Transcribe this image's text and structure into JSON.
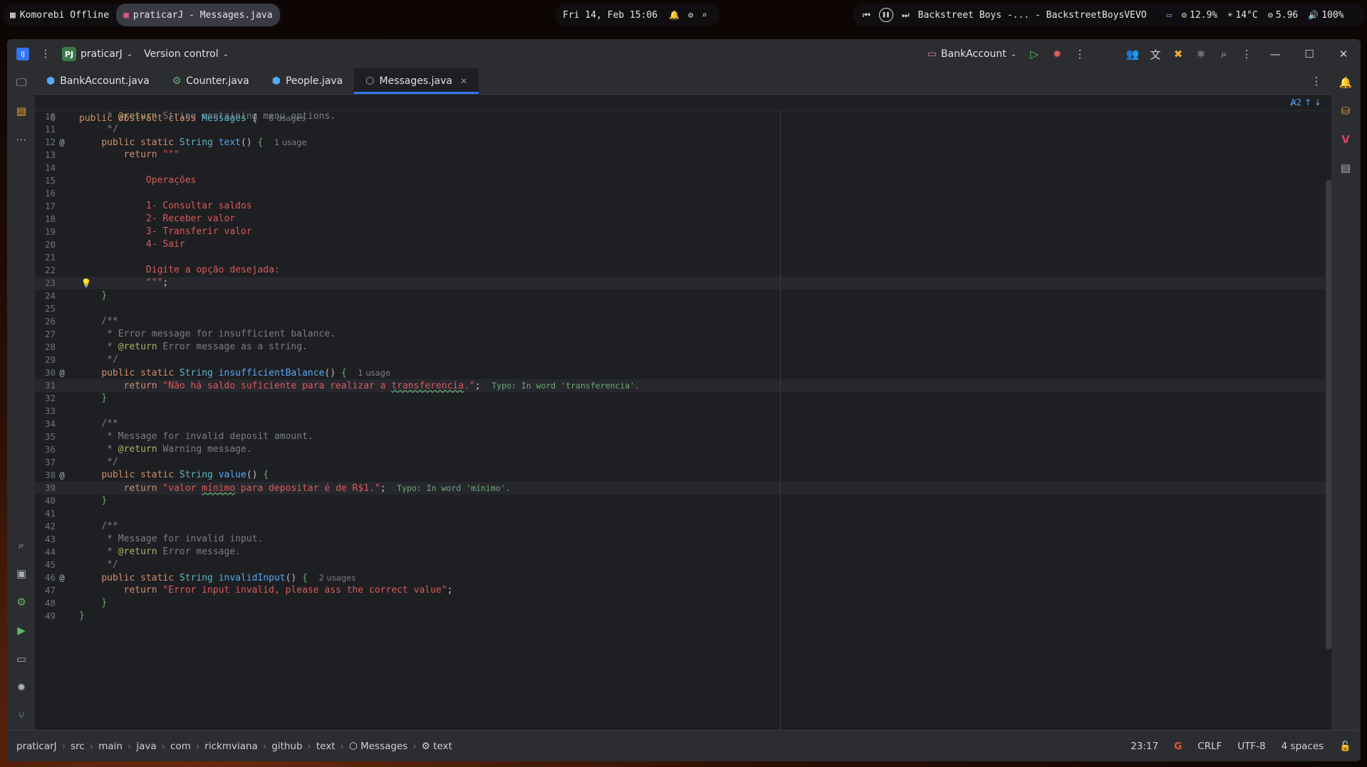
{
  "system_bar": {
    "workspace": "Komorebi Offline",
    "active_window": "praticarJ - Messages.java",
    "datetime": "Fri 14, Feb 15:06",
    "media_title": "Backstreet Boys -... - BackstreetBoysVEVO",
    "cpu": "12.9%",
    "weather": "14°C",
    "memory": "5.96",
    "volume": "100%"
  },
  "titlebar": {
    "project_badge": "PJ",
    "project_name": "praticarJ",
    "vcs": "Version control",
    "run_config": "BankAccount"
  },
  "tabs": [
    {
      "label": "BankAccount.java",
      "icon": "class-icon",
      "active": false
    },
    {
      "label": "Counter.java",
      "icon": "class-icon",
      "active": false
    },
    {
      "label": "People.java",
      "icon": "class-icon",
      "active": false
    },
    {
      "label": "Messages.java",
      "icon": "abstract-class-icon",
      "active": true
    }
  ],
  "editor": {
    "sticky": {
      "num": "6",
      "usages": "6 usages"
    },
    "inspection_count": "2",
    "lines": [
      {
        "n": "10"
      },
      {
        "n": "11"
      },
      {
        "n": "12",
        "usages": "1 usage"
      },
      {
        "n": "13"
      },
      {
        "n": "14"
      },
      {
        "n": "15"
      },
      {
        "n": "16"
      },
      {
        "n": "17"
      },
      {
        "n": "18"
      },
      {
        "n": "19"
      },
      {
        "n": "20"
      },
      {
        "n": "21"
      },
      {
        "n": "22"
      },
      {
        "n": "23"
      },
      {
        "n": "24"
      },
      {
        "n": "25"
      },
      {
        "n": "26"
      },
      {
        "n": "27"
      },
      {
        "n": "28"
      },
      {
        "n": "29"
      },
      {
        "n": "30",
        "usages": "1 usage"
      },
      {
        "n": "31",
        "typo": "Typo: In word 'transferencia'."
      },
      {
        "n": "32"
      },
      {
        "n": "33"
      },
      {
        "n": "34"
      },
      {
        "n": "35"
      },
      {
        "n": "36"
      },
      {
        "n": "37"
      },
      {
        "n": "38"
      },
      {
        "n": "39",
        "typo": "Typo: In word 'mínimo'."
      },
      {
        "n": "40"
      },
      {
        "n": "41"
      },
      {
        "n": "42"
      },
      {
        "n": "43"
      },
      {
        "n": "44"
      },
      {
        "n": "45"
      },
      {
        "n": "46",
        "usages": "2 usages"
      },
      {
        "n": "47"
      },
      {
        "n": "48"
      },
      {
        "n": "49"
      }
    ]
  },
  "breadcrumb": [
    "praticarJ",
    "src",
    "main",
    "java",
    "com",
    "rickmviana",
    "github",
    "text",
    "Messages",
    "text"
  ],
  "status": {
    "position": "23:17",
    "line_ending": "CRLF",
    "encoding": "UTF-8",
    "indent": "4 spaces"
  },
  "colors": {
    "accent": "#3574f0",
    "keyword": "#cf8e6d",
    "string": "#d85a5a"
  }
}
